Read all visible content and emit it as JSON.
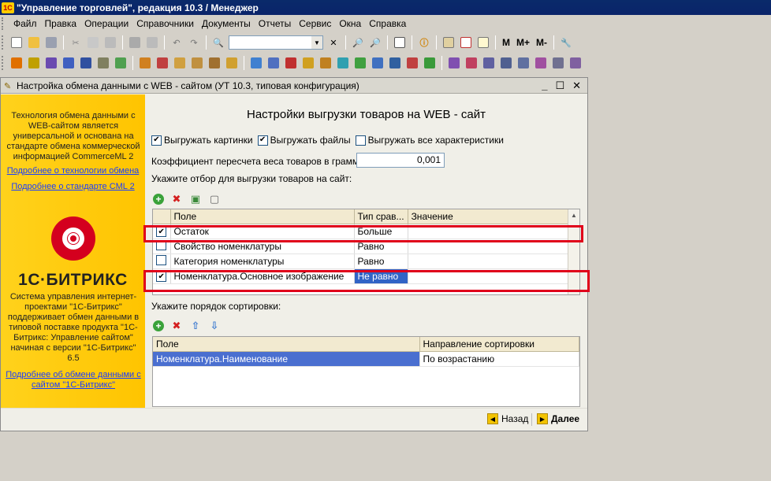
{
  "window": {
    "app_logo": "1С",
    "title": "\"Управление торговлей\", редакция 10.3 / Менеджер"
  },
  "menu": [
    "Файл",
    "Правка",
    "Операции",
    "Справочники",
    "Документы",
    "Отчеты",
    "Сервис",
    "Окна",
    "Справка"
  ],
  "toolbar": {
    "m_label": "M",
    "mplus_label": "M+",
    "mminus_label": "M-",
    "search_value": "",
    "clear_glyph": "✕"
  },
  "dialog": {
    "title": "Настройка обмена данными с WEB - сайтом (УТ 10.3, типовая конфигурация)",
    "heading": "Настройки выгрузки товаров на WEB - сайт",
    "checkboxes": [
      {
        "label": "Выгружать картинки",
        "checked": "✔"
      },
      {
        "label": "Выгружать файлы",
        "checked": "✔"
      },
      {
        "label": "Выгружать все характеристики",
        "checked": ""
      }
    ],
    "coef_label": "Коэффициент пересчета веса товаров в граммы:",
    "coef_value": "0,001",
    "filter_label": "Укажите отбор для выгрузки товаров на сайт:",
    "filter_columns": [
      "Поле",
      "Тип срав...",
      "Значение"
    ],
    "filter_rows": [
      {
        "checked": "✔",
        "field": "Остаток",
        "compare": "Больше",
        "value": ""
      },
      {
        "checked": "",
        "field": "Свойство номенклатуры",
        "compare": "Равно",
        "value": ""
      },
      {
        "checked": "",
        "field": "Категория номенклатуры",
        "compare": "Равно",
        "value": ""
      },
      {
        "checked": "✔",
        "field": "Номенклатура.Основное изображение",
        "compare": "Не равно",
        "value": ""
      }
    ],
    "sort_label": "Укажите порядок сортировки:",
    "sort_columns": [
      "Поле",
      "Направление сортировки"
    ],
    "sort_rows": [
      {
        "field": "Номенклатура.Наименование",
        "direction": "По возрастанию"
      }
    ],
    "back_label": "Назад",
    "next_label": "Далее"
  },
  "side": {
    "intro": "Технология обмена данными с WEB-сайтом является универсальной и основана на стандарте обмена коммерческой информацией CommerceML 2",
    "link_tech": "Подробнее о технологии обмена",
    "link_cml": "Подробнее о стандарте CML 2",
    "logo_text": "1С·БИТРИКС",
    "description": "Система управления интернет-проектами \"1С-Битрикс\" поддерживает обмен данными в типовой поставке продукта \"1С-Битрикс: Управление сайтом\" начиная с версии \"1С-Битрикс\" 6.5",
    "link_bitrix": "Подробнее об обмене данными с сайтом \"1С-Битрикс\""
  },
  "colors": {
    "titlebar": "#0a246a",
    "side_panel": "#ffc800",
    "highlight": "#e0001a",
    "selection": "#3164c6",
    "link": "#1a3cff"
  }
}
